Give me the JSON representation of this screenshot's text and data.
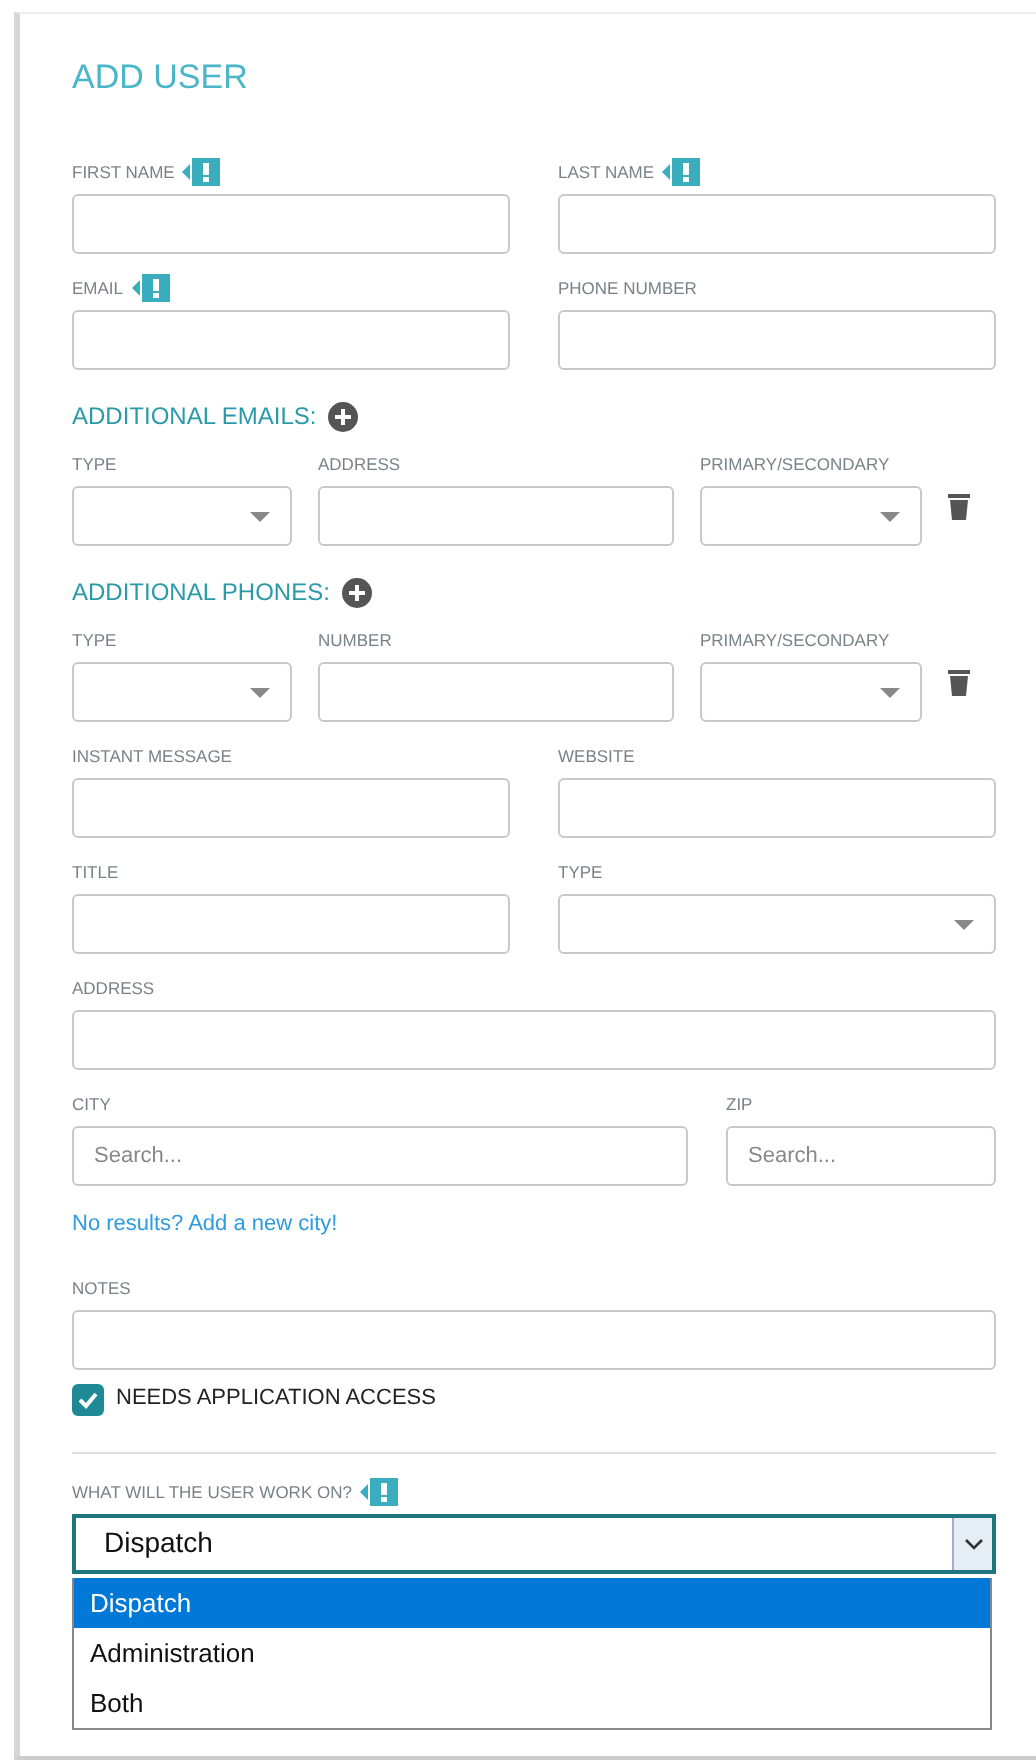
{
  "title": "ADD USER",
  "rows": [
    {
      "kind": "pair",
      "fields": [
        {
          "label": "FIRST NAME",
          "required": true,
          "kind": "text"
        },
        {
          "label": "LAST NAME",
          "required": true,
          "kind": "text"
        }
      ]
    },
    {
      "kind": "pair",
      "fields": [
        {
          "label": "EMAIL",
          "required": true,
          "kind": "text"
        },
        {
          "label": "PHONE NUMBER",
          "required": false,
          "kind": "text"
        }
      ]
    },
    {
      "kind": "heading",
      "text": "ADDITIONAL EMAILS:"
    },
    {
      "kind": "triple",
      "fields": [
        {
          "label": "TYPE",
          "required": false,
          "kind": "select"
        },
        {
          "label": "ADDRESS",
          "required": false,
          "kind": "text"
        },
        {
          "label": "PRIMARY/SECONDARY",
          "required": false,
          "kind": "select"
        }
      ]
    },
    {
      "kind": "heading",
      "text": "ADDITIONAL PHONES:"
    },
    {
      "kind": "triple",
      "fields": [
        {
          "label": "TYPE",
          "required": false,
          "kind": "select"
        },
        {
          "label": "NUMBER",
          "required": false,
          "kind": "text"
        },
        {
          "label": "PRIMARY/SECONDARY",
          "required": false,
          "kind": "select"
        }
      ]
    },
    {
      "kind": "pair",
      "fields": [
        {
          "label": "INSTANT MESSAGE",
          "required": false,
          "kind": "text"
        },
        {
          "label": "WEBSITE",
          "required": false,
          "kind": "text"
        }
      ]
    },
    {
      "kind": "pair",
      "fields": [
        {
          "label": "TITLE",
          "required": false,
          "kind": "text"
        },
        {
          "label": "TYPE",
          "required": false,
          "kind": "select"
        }
      ]
    },
    {
      "kind": "single",
      "fields": [
        {
          "label": "ADDRESS",
          "required": false,
          "kind": "text"
        }
      ]
    },
    {
      "kind": "city",
      "fields": [
        {
          "label": "CITY",
          "required": false,
          "kind": "text",
          "placeholder": "Search..."
        },
        {
          "label": "ZIP",
          "required": false,
          "kind": "text",
          "placeholder": "Search..."
        }
      ]
    },
    {
      "kind": "link",
      "text": "No results? Add a new city!"
    },
    {
      "kind": "single",
      "fields": [
        {
          "label": "NOTES",
          "required": false,
          "kind": "text"
        }
      ]
    },
    {
      "kind": "checkbox",
      "label": "NEEDS APPLICATION ACCESS",
      "checked": true
    },
    {
      "kind": "divider"
    },
    {
      "kind": "dropdown",
      "label": "WHAT WILL THE USER WORK ON?",
      "required": true,
      "value": "Dispatch",
      "options": [
        {
          "text": "Dispatch",
          "selected": true
        },
        {
          "text": "Administration",
          "selected": false
        },
        {
          "text": "Both",
          "selected": false
        }
      ]
    }
  ]
}
